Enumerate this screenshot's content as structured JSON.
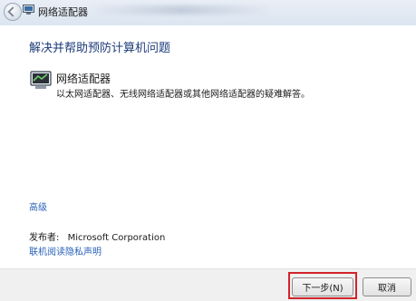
{
  "window": {
    "title": "网络适配器"
  },
  "main": {
    "heading": "解决并帮助预防计算机问题",
    "item": {
      "title": "网络适配器",
      "description": "以太网适配器、无线网络适配器或其他网络适配器的疑难解答。"
    },
    "advanced_link": "高级",
    "publisher_label": "发布者:",
    "publisher_value": "Microsoft Corporation",
    "privacy_link": "联机阅读隐私声明"
  },
  "footer": {
    "next_label": "下一步(N)",
    "cancel_label": "取消"
  },
  "colors": {
    "heading": "#1d3b7a",
    "link": "#2a62b9",
    "highlight": "#d2232a"
  },
  "icons": {
    "back": "back-arrow-icon",
    "title": "network-adapter-icon",
    "item": "network-adapter-icon"
  }
}
